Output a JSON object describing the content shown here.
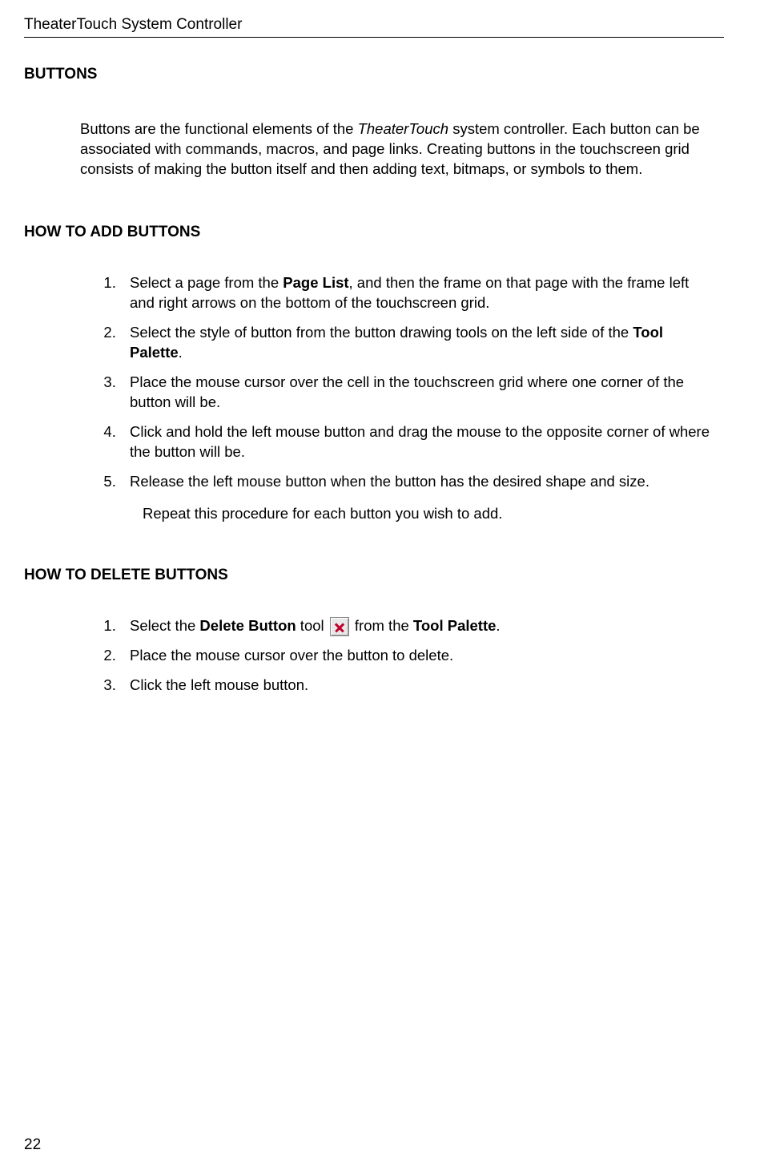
{
  "header": {
    "title": "TheaterTouch System Controller"
  },
  "sections": {
    "buttons": {
      "heading": "BUTTONS",
      "intro_pre": "Buttons are the functional elements of the ",
      "intro_italic": "TheaterTouch",
      "intro_post": " system controller.  Each button can be associated with commands, macros, and page links. Creating buttons in the touchscreen grid consists of making the button itself and then adding text, bitmaps, or symbols to them."
    },
    "add": {
      "heading": "HOW TO ADD BUTTONS",
      "steps": [
        {
          "pre": "Select a page from the ",
          "b1": "Page List",
          "post": ", and then the frame on that page with the frame left and right arrows on the bottom of the touchscreen grid."
        },
        {
          "pre": "Select the style of button from the button drawing tools on the left side of the ",
          "b1": "Tool Palette",
          "post": "."
        },
        {
          "pre": "Place the mouse cursor over the cell in the touchscreen grid where one corner of the button will be."
        },
        {
          "pre": "Click and hold the left mouse button and drag the mouse to the opposite corner of where the button will be."
        },
        {
          "pre": "Release the left mouse button when the button has the desired shape and size."
        }
      ],
      "repeat": "Repeat this procedure for each button you wish to add."
    },
    "delete": {
      "heading": "HOW TO DELETE BUTTONS",
      "steps": [
        {
          "pre": "Select the ",
          "b1": "Delete Button",
          "mid": " tool ",
          "icon": "x-icon",
          "post2a": " from the ",
          "b2": "Tool Palette",
          "post2b": "."
        },
        {
          "pre": "Place the mouse cursor over the button to delete."
        },
        {
          "pre": "Click the left mouse button."
        }
      ]
    }
  },
  "page_number": "22"
}
